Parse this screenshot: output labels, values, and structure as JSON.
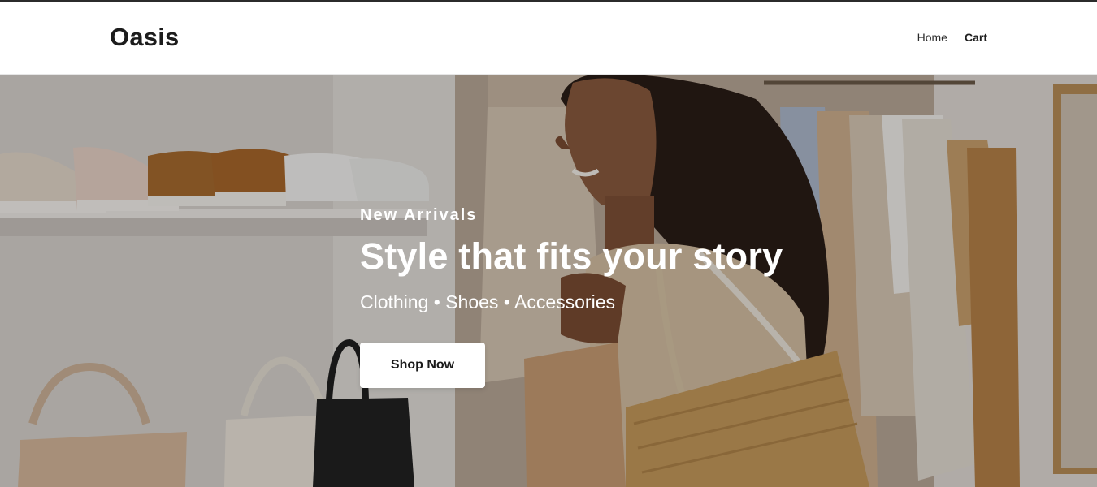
{
  "header": {
    "logo": "Oasis",
    "nav": [
      {
        "label": "Home",
        "active": false
      },
      {
        "label": "Cart",
        "active": true
      }
    ]
  },
  "hero": {
    "eyebrow": "New Arrivals",
    "headline": "Style that fits your story",
    "subline": "Clothing • Shoes • Accessories",
    "cta_label": "Shop Now"
  },
  "colors": {
    "text_dark": "#1c1c1c",
    "hero_text": "#ffffff",
    "cta_bg": "#ffffff"
  }
}
